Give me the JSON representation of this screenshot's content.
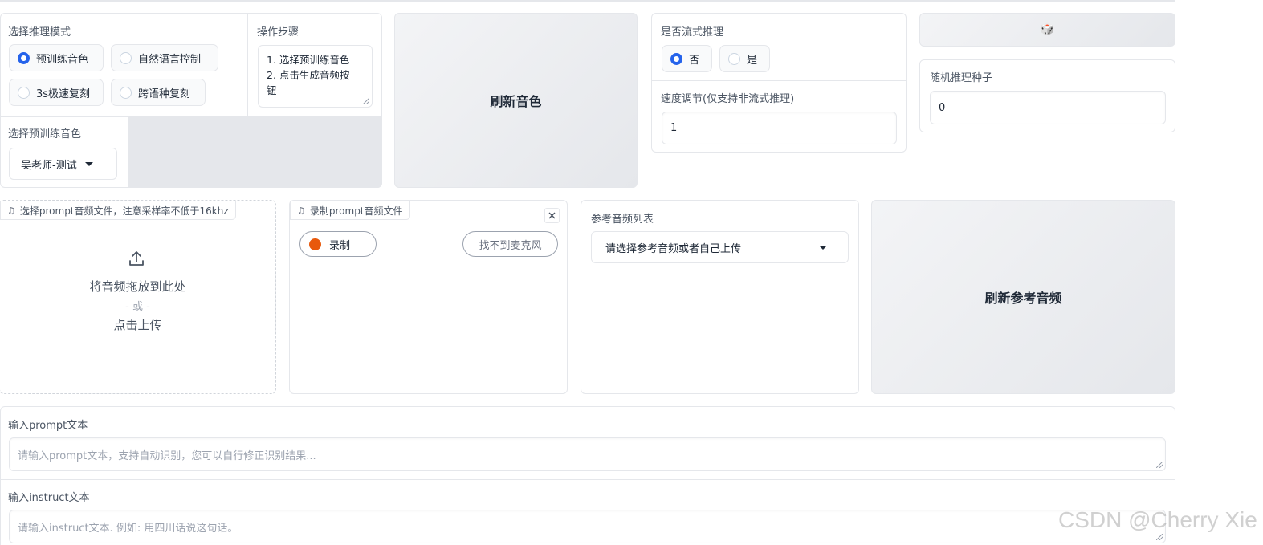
{
  "mode": {
    "label": "选择推理模式",
    "options": [
      "预训练音色",
      "自然语言控制",
      "3s极速复刻",
      "跨语种复刻"
    ],
    "selected": "预训练音色"
  },
  "steps": {
    "label": "操作步骤",
    "lines": [
      "1. 选择预训练音色",
      "2. 点击生成音频按",
      "钮"
    ]
  },
  "voice": {
    "label": "选择预训练音色",
    "value": "吴老师-测试"
  },
  "refresh_voice_label": "刷新音色",
  "stream": {
    "label": "是否流式推理",
    "options": [
      "否",
      "是"
    ],
    "selected": "否"
  },
  "speed": {
    "label": "速度调节(仅支持非流式推理)",
    "value": "1"
  },
  "dice": {
    "icon": "dice-icon",
    "glyph": "🎲"
  },
  "seed": {
    "label": "随机推理种子",
    "value": "0"
  },
  "upload": {
    "chip": "选择prompt音频文件，注意采样率不低于16khz",
    "drop_text": "将音频拖放到此处",
    "or_text": "- 或 -",
    "click_text": "点击上传"
  },
  "record": {
    "chip": "录制prompt音频文件",
    "record_label": "录制",
    "mic_label": "找不到麦克风"
  },
  "ref_audio": {
    "label": "参考音频列表",
    "value": "请选择参考音频或者自己上传"
  },
  "refresh_ref_label": "刷新参考音频",
  "prompt": {
    "label": "输入prompt文本",
    "placeholder": "请输入prompt文本，支持自动识别，您可以自行修正识别结果..."
  },
  "instruct": {
    "label": "输入instruct文本",
    "placeholder": "请输入instruct文本. 例如: 用四川话说这句话。"
  },
  "watermark": "CSDN @Cherry Xie",
  "colors": {
    "accent": "#2563eb",
    "record_dot": "#e8590c",
    "border": "#e5e7eb"
  }
}
